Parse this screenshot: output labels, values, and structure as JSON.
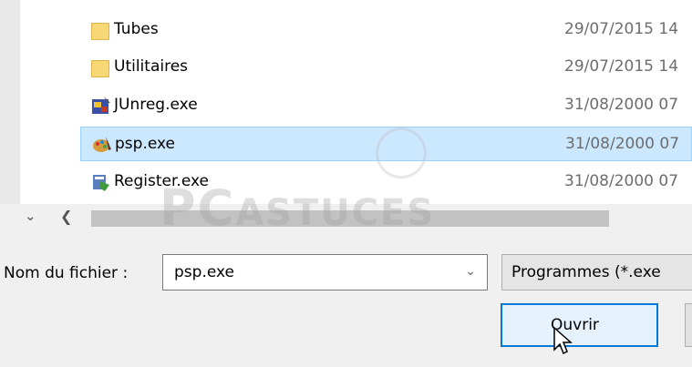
{
  "files": [
    {
      "name": "Tubes",
      "date": "29/07/2015 14",
      "icon": "folder-icon",
      "selected": false
    },
    {
      "name": "Utilitaires",
      "date": "29/07/2015 14",
      "icon": "folder-icon",
      "selected": false
    },
    {
      "name": "JUnreg.exe",
      "date": "31/08/2000 07",
      "icon": "junreg-app-icon",
      "selected": false
    },
    {
      "name": "psp.exe",
      "date": "31/08/2000 07",
      "icon": "psp-app-icon",
      "selected": true
    },
    {
      "name": "Register.exe",
      "date": "31/08/2000 07",
      "icon": "register-app-icon",
      "selected": false
    }
  ],
  "watermark": {
    "part1": "PC",
    "part2": "ASTUCES"
  },
  "filename": {
    "label": "Nom du fichier :",
    "value": "psp.exe"
  },
  "filetype": {
    "value": "Programmes (*.exe"
  },
  "open_button": {
    "label": "Ouvrir"
  },
  "colors": {
    "selection": "#cce8ff",
    "accent": "#0078d7"
  }
}
